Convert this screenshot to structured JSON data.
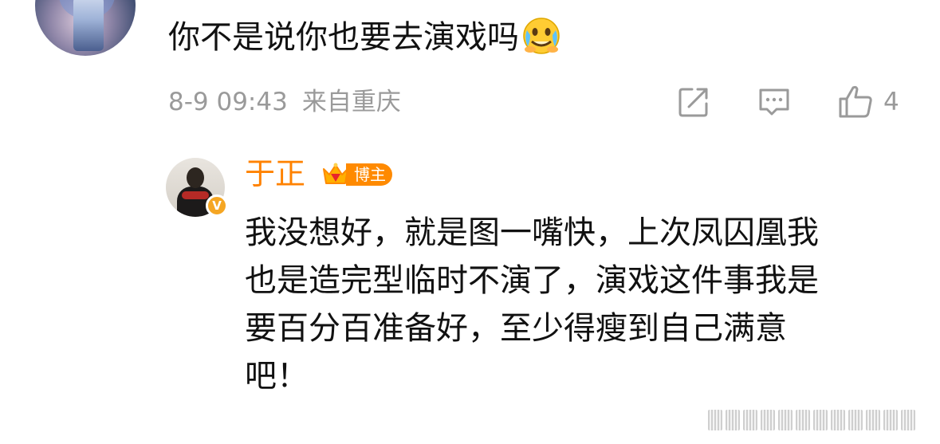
{
  "comment": {
    "text": "你不是说你也要去演戏吗",
    "emoji": "crying-smile-emoji",
    "date": "8-9 09:43",
    "location": "来自重庆",
    "like_count": "4",
    "icons": {
      "share": "share-icon",
      "reply": "comment-icon",
      "like": "thumbs-up-icon"
    }
  },
  "reply": {
    "author": "于正",
    "badge_label": "博主",
    "verified": "V",
    "lines": [
      "我没想好，就是图一嘴快，上次凤囚凰我",
      "也是造完型临时不演了，演戏这件事我是",
      "要百分百准备好，至少得瘦到自己满意",
      "吧！"
    ]
  },
  "colors": {
    "author": "#ff8200",
    "meta": "#9a9a9a",
    "text": "#111111",
    "badge": "#ff8a00",
    "verified": "#f5a623"
  }
}
